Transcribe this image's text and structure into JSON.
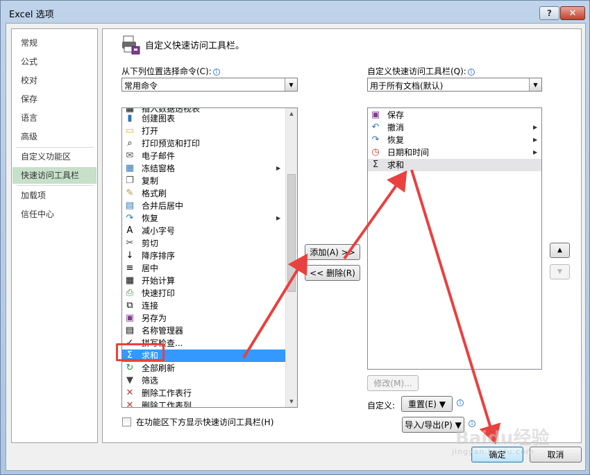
{
  "window": {
    "title": "Excel 选项",
    "help_label": "?",
    "close_label": "✕"
  },
  "sidebar": {
    "items": [
      {
        "label": "常规"
      },
      {
        "label": "公式"
      },
      {
        "label": "校对"
      },
      {
        "label": "保存"
      },
      {
        "label": "语言"
      },
      {
        "label": "高级"
      },
      {
        "label": "自定义功能区"
      },
      {
        "label": "快速访问工具栏",
        "active": true
      },
      {
        "label": "加载项"
      },
      {
        "label": "信任中心"
      }
    ]
  },
  "header": {
    "text": "自定义快速访问工具栏。",
    "icon": "toolbar-customize-icon"
  },
  "left_panel": {
    "label": "从下列位置选择命令(C):",
    "info": "i",
    "dropdown_value": "常用命令",
    "partial_top": "插入数据透视表",
    "commands": [
      {
        "label": "创建图表",
        "icon": "chart-icon"
      },
      {
        "label": "打开",
        "icon": "folder-icon"
      },
      {
        "label": "打印预览和打印",
        "icon": "print-preview-icon"
      },
      {
        "label": "电子邮件",
        "icon": "email-icon"
      },
      {
        "label": "冻结窗格",
        "icon": "freeze-panes-icon",
        "submenu": true
      },
      {
        "label": "复制",
        "icon": "copy-icon"
      },
      {
        "label": "格式刷",
        "icon": "format-painter-icon"
      },
      {
        "label": "合并后居中",
        "icon": "merge-center-icon"
      },
      {
        "label": "恢复",
        "icon": "redo-icon",
        "submenu": true
      },
      {
        "label": "减小字号",
        "icon": "font-size-decrease-icon"
      },
      {
        "label": "剪切",
        "icon": "cut-icon"
      },
      {
        "label": "降序排序",
        "icon": "sort-descending-icon"
      },
      {
        "label": "居中",
        "icon": "align-center-icon"
      },
      {
        "label": "开始计算",
        "icon": "calculate-icon"
      },
      {
        "label": "快速打印",
        "icon": "quick-print-icon"
      },
      {
        "label": "连接",
        "icon": "connections-icon"
      },
      {
        "label": "另存为",
        "icon": "save-as-icon"
      },
      {
        "label": "名称管理器",
        "icon": "name-manager-icon"
      },
      {
        "label": "拼写检查...",
        "icon": "spelling-icon"
      },
      {
        "label": "求和",
        "icon": "sum-icon",
        "selected": true
      },
      {
        "label": "全部刷新",
        "icon": "refresh-all-icon"
      },
      {
        "label": "筛选",
        "icon": "filter-icon"
      },
      {
        "label": "删除工作表行",
        "icon": "delete-row-icon"
      },
      {
        "label": "删除工作表列",
        "icon": "delete-column-icon"
      }
    ]
  },
  "right_panel": {
    "label": "自定义快速访问工具栏(Q):",
    "info": "i",
    "dropdown_value": "用于所有文档(默认)",
    "items": [
      {
        "label": "保存",
        "icon": "save-icon"
      },
      {
        "label": "撤消",
        "icon": "undo-icon",
        "submenu": true
      },
      {
        "label": "恢复",
        "icon": "redo-icon",
        "submenu": true
      },
      {
        "label": "日期和时间",
        "icon": "date-time-icon",
        "submenu": true
      },
      {
        "label": "求和",
        "icon": "sum-icon",
        "highlighted": true
      }
    ]
  },
  "buttons": {
    "add": "添加(A) >>",
    "remove": "<< 删除(R)",
    "modify": "修改(M)...",
    "customize_label": "自定义:",
    "reset": "重置(E) ▼",
    "import_export": "导入/导出(P) ▼",
    "move_up": "▲",
    "move_down": "▼",
    "ok": "确定",
    "cancel": "取消"
  },
  "checkbox": {
    "label": "在功能区下方显示快速访问工具栏(H)",
    "checked": false
  },
  "colors": {
    "selection": "#3399ff",
    "sidebar_active": "#c7e0c9",
    "annotation": "#e8413f"
  }
}
